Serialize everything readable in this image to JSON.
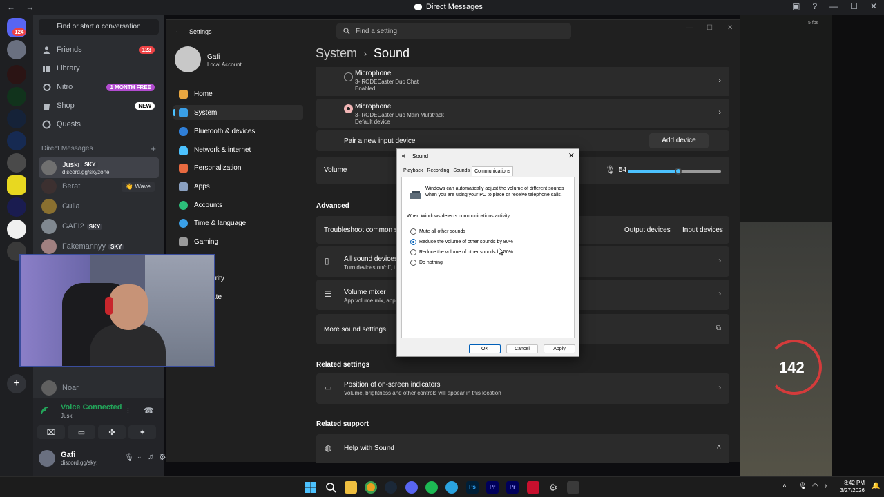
{
  "discord": {
    "window_title": "Direct Messages",
    "find_conversation": "Find or start a conversation",
    "server_badge": "124",
    "nav": [
      {
        "label": "Friends",
        "badge": "123"
      },
      {
        "label": "Library",
        "badge": ""
      },
      {
        "label": "Nitro",
        "badge": "1 MONTH FREE"
      },
      {
        "label": "Shop",
        "badge": "NEW"
      },
      {
        "label": "Quests",
        "badge": ""
      }
    ],
    "dm_header": "Direct Messages",
    "dms": [
      {
        "name": "Juski",
        "tag": "SKY",
        "sub": "discord.gg/skyzone",
        "extra": ""
      },
      {
        "name": "Berat",
        "tag": "",
        "sub": "",
        "extra": "Wave"
      },
      {
        "name": "Gulla",
        "tag": "",
        "sub": "",
        "extra": ""
      },
      {
        "name": "GAFI2",
        "tag": "SKY",
        "sub": "",
        "extra": ""
      },
      {
        "name": "Fakemannyy",
        "tag": "SKY",
        "sub": "",
        "extra": ""
      },
      {
        "name": "Noar",
        "tag": "",
        "sub": "",
        "extra": ""
      }
    ],
    "voice": {
      "status": "Voice Connected",
      "channel": "Juski"
    },
    "user": {
      "name": "Gafi",
      "status": "discord.gg/sky:"
    }
  },
  "settings": {
    "window_title": "Settings",
    "search_placeholder": "Find a setting",
    "profile": {
      "name": "Gafi",
      "account": "Local Account"
    },
    "nav": [
      "Home",
      "System",
      "Bluetooth & devices",
      "Network & internet",
      "Personalization",
      "Apps",
      "Accounts",
      "Time & language",
      "Gaming",
      "ility",
      "& security",
      "s Update"
    ],
    "breadcrumb": {
      "parent": "System",
      "current": "Sound"
    },
    "inputs": [
      {
        "title": "Microphone",
        "device": "3- RODECaster Duo Chat",
        "state": "Enabled"
      },
      {
        "title": "Microphone",
        "device": "3- RODECaster Duo Main Multitrack",
        "state": "Default device"
      }
    ],
    "pair_label": "Pair a new input device",
    "add_device": "Add device",
    "volume_label": "Volume",
    "volume_value": "54",
    "volume_level": 0.54,
    "advanced": "Advanced",
    "troubleshoot": "Troubleshoot common so",
    "output_devices": "Output devices",
    "input_devices": "Input devices",
    "all_devices": {
      "title": "All sound devices",
      "sub": "Turn devices on/off, t"
    },
    "mixer": {
      "title": "Volume mixer",
      "sub": "App volume mix, app"
    },
    "more_sound": "More sound settings",
    "related_settings": "Related settings",
    "onscreen": {
      "title": "Position of on-screen indicators",
      "sub": "Volume, brightness and other controls will appear in this location"
    },
    "related_support": "Related support",
    "help": "Help with Sound"
  },
  "dialog": {
    "title": "Sound",
    "tabs": [
      "Playback",
      "Recording",
      "Sounds",
      "Communications"
    ],
    "selected_tab": "Communications",
    "intro": "Windows can automatically adjust the volume of different sounds when you are using your PC to place or receive telephone calls.",
    "prompt": "When Windows detects communications activity:",
    "options": [
      "Mute all other sounds",
      "Reduce the volume of other sounds by 80%",
      "Reduce the volume of other sounds by 50%",
      "Do nothing"
    ],
    "selected_option": 1,
    "buttons": {
      "ok": "OK",
      "cancel": "Cancel",
      "apply": "Apply"
    }
  },
  "game": {
    "speed": "142",
    "hud_top": "5 fps"
  },
  "taskbar": {
    "time": "8:42 PM",
    "date": "3/27/2026"
  },
  "colors": {
    "discord_green": "#23a55a",
    "accent_blue": "#4cc2ff",
    "nitro_purple": "#b24bd0"
  }
}
